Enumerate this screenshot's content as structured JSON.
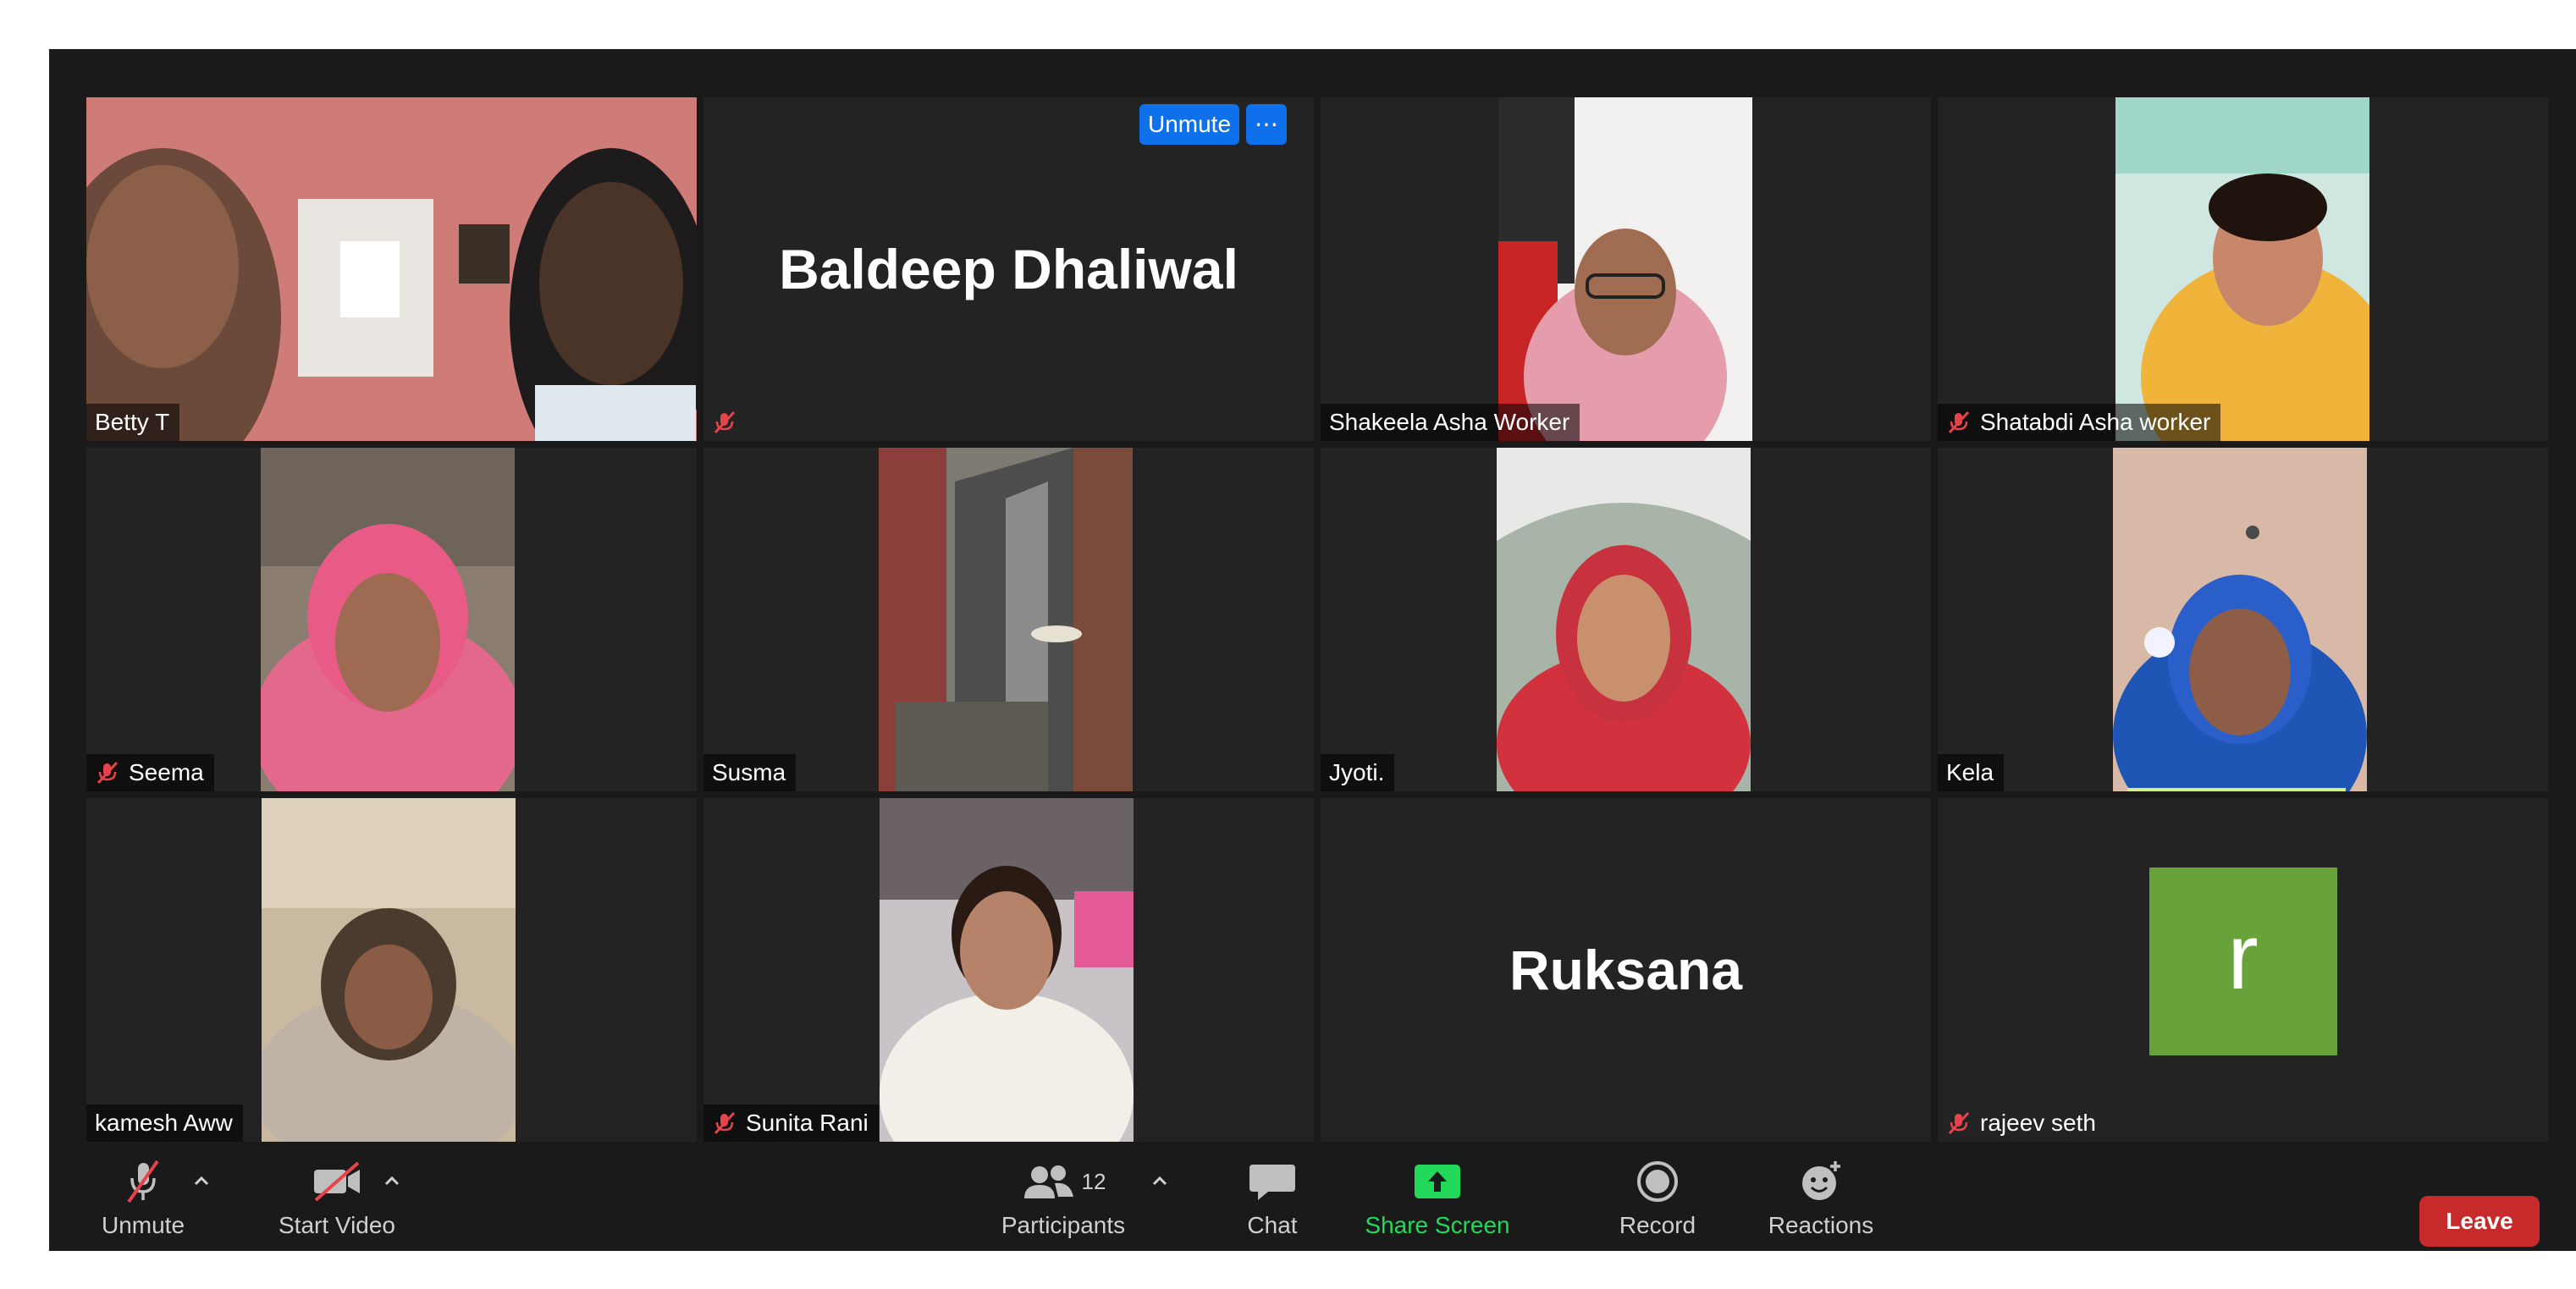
{
  "tiles": [
    {
      "name": "Betty T",
      "muted": false,
      "active": true
    },
    {
      "name": "Baldeep Dhaliwal",
      "muted": true,
      "display_name": "Baldeep Dhaliwal",
      "unmute_label": "Unmute",
      "more_label": "⋯"
    },
    {
      "name": "Shakeela Asha Worker",
      "muted": false
    },
    {
      "name": "Shatabdi Asha worker",
      "muted": true
    },
    {
      "name": "Seema",
      "muted": true
    },
    {
      "name": "Susma",
      "muted": false
    },
    {
      "name": "Jyoti.",
      "muted": false
    },
    {
      "name": "Kela",
      "muted": false,
      "speaking": true
    },
    {
      "name": "kamesh Aww",
      "muted": false
    },
    {
      "name": "Sunita Rani",
      "muted": true
    },
    {
      "name": "Ruksana",
      "muted": false,
      "display_name": "Ruksana"
    },
    {
      "name": "rajeev seth",
      "muted": true,
      "avatar_letter": "r"
    }
  ],
  "toolbar": {
    "unmute": "Unmute",
    "start_video": "Start Video",
    "participants": "Participants",
    "participants_count": "12",
    "chat": "Chat",
    "share_screen": "Share Screen",
    "record": "Record",
    "reactions": "Reactions",
    "leave": "Leave"
  },
  "colors": {
    "active_speaker": "#d9ee86",
    "share_screen": "#23d959",
    "leave": "#c62a2a",
    "accent_blue": "#0e71eb",
    "avatar_green": "#67a23b",
    "mute_red": "#e8424a"
  }
}
